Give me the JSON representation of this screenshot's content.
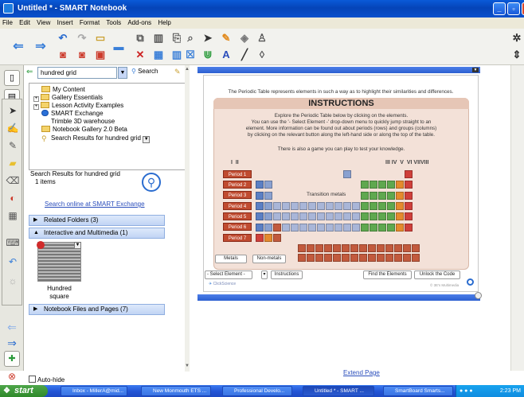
{
  "window": {
    "title": "Untitled * - SMART Notebook"
  },
  "menu": [
    "File",
    "Edit",
    "View",
    "Insert",
    "Format",
    "Tools",
    "Add-ons",
    "Help"
  ],
  "gallery": {
    "search_value": "hundred grid",
    "search_button": "Search",
    "tree": [
      "My Content",
      "Gallery Essentials",
      "Lesson Activity Examples",
      "SMART Exchange",
      "Trimble 3D warehouse",
      "Notebook Gallery 2.0 Beta",
      "Search Results for hundred grid"
    ],
    "results_title": "Search Results for hundred grid",
    "results_count": "1 items",
    "online_link": "Search online at SMART Exchange",
    "sections": [
      "Related Folders (3)",
      "Interactive and Multimedia (1)",
      "Notebook Files and Pages (7)"
    ],
    "item_label": "Hundred square",
    "autohide_label": "Auto-hide"
  },
  "page": {
    "top_text": "The Periodic Table represents elements in such a way as to highlight their similarities and differences.",
    "inst_title": "INSTRUCTIONS",
    "inst_lines": [
      "Explore the Periodic Table below by clicking on the elements.",
      "You can use the '- Select Element -' drop-down menu to quickly jump straight to an",
      "element. More information can be found out about periods (rows) and groups (columns)",
      "by clicking on the relevant button along the left-hand side or along the top of the table."
    ],
    "game_line": "There is also a game you can play to test your knowledge.",
    "groups_left": "I  II",
    "groups_right": "III IV  V  VI VIIVIII",
    "periods": [
      "Period 1",
      "Period 2",
      "Period 3",
      "Period 4",
      "Period 5",
      "Period 6",
      "Period 7"
    ],
    "transition_label": "Transition metals",
    "metals_btn": "Metals",
    "nonmetals_btn": "Non-metals",
    "select_element": "- Select Element -",
    "instructions_btn": "Instructions",
    "find_btn": "Find the Elements",
    "unlock_btn": "Unlock the Code",
    "footer_left": "ClickScience",
    "footer_right": "© 3E's Multimedia",
    "extend_link": "Extend Page"
  },
  "taskbar": {
    "start": "start",
    "tasks": [
      "Inbox - MillerA@mid...",
      "New Monmouth ETS ...",
      "Professional Develo...",
      "Untitled * - SMART ...",
      "SmartBoard Smarts..."
    ],
    "clock": "2:23 PM"
  }
}
